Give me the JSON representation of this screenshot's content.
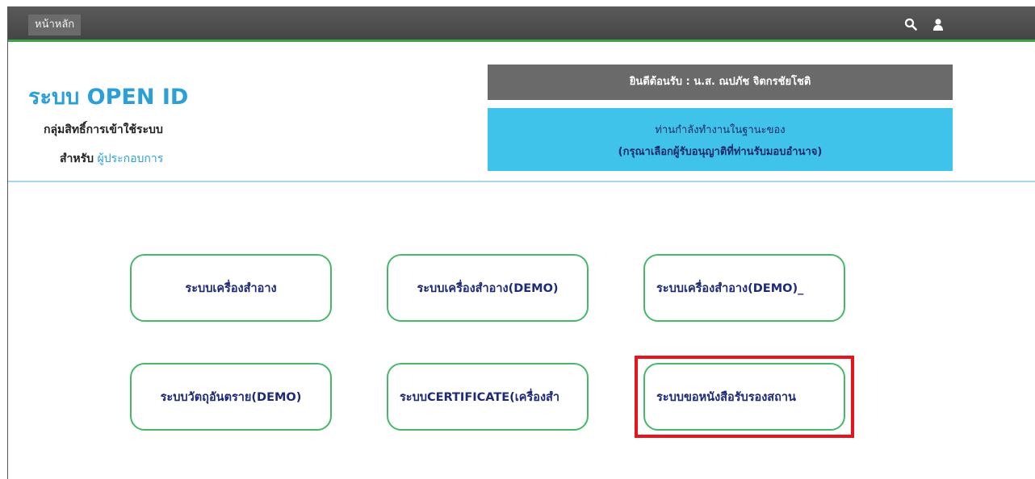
{
  "nav": {
    "home_label": "หน้าหลัก",
    "search_icon": "search-icon",
    "user_icon": "user-icon"
  },
  "header": {
    "title": "ระบบ OPEN ID",
    "subtitle": "กลุ่มสิทธิ์การเข้าใช้ระบบ",
    "for_label": "สำหรับ",
    "for_value": "ผู้ประกอบการ"
  },
  "welcome": {
    "text": "ยินดีต้อนรับ : น.ส. ณปภัช จิตกรชัยโชติ"
  },
  "role": {
    "line1": "ท่านกำลังทำงานในฐานะของ",
    "line2": "(กรุณาเลือกผู้รับอนุญาติที่ท่านรับมอบอำนาจ)"
  },
  "systems": [
    {
      "label": "ระบบเครื่องสำอาง"
    },
    {
      "label": "ระบบเครื่องสำอาง(DEMO)"
    },
    {
      "label": "ระบบเครื่องสำอาง(DEMO)_"
    },
    {
      "label": "ระบบวัตถุอันตราย(DEMO)"
    },
    {
      "label": "ระบบCERTIFICATE(เครื่องสำ"
    },
    {
      "label": "ระบบขอหนังสือรับรองสถาน"
    }
  ],
  "colors": {
    "accent": "#2a9fd8",
    "green": "#45b86a",
    "highlight": "#e8141b",
    "role_bg": "#3fc3ea",
    "welcome_bg": "#6a6a6a"
  }
}
